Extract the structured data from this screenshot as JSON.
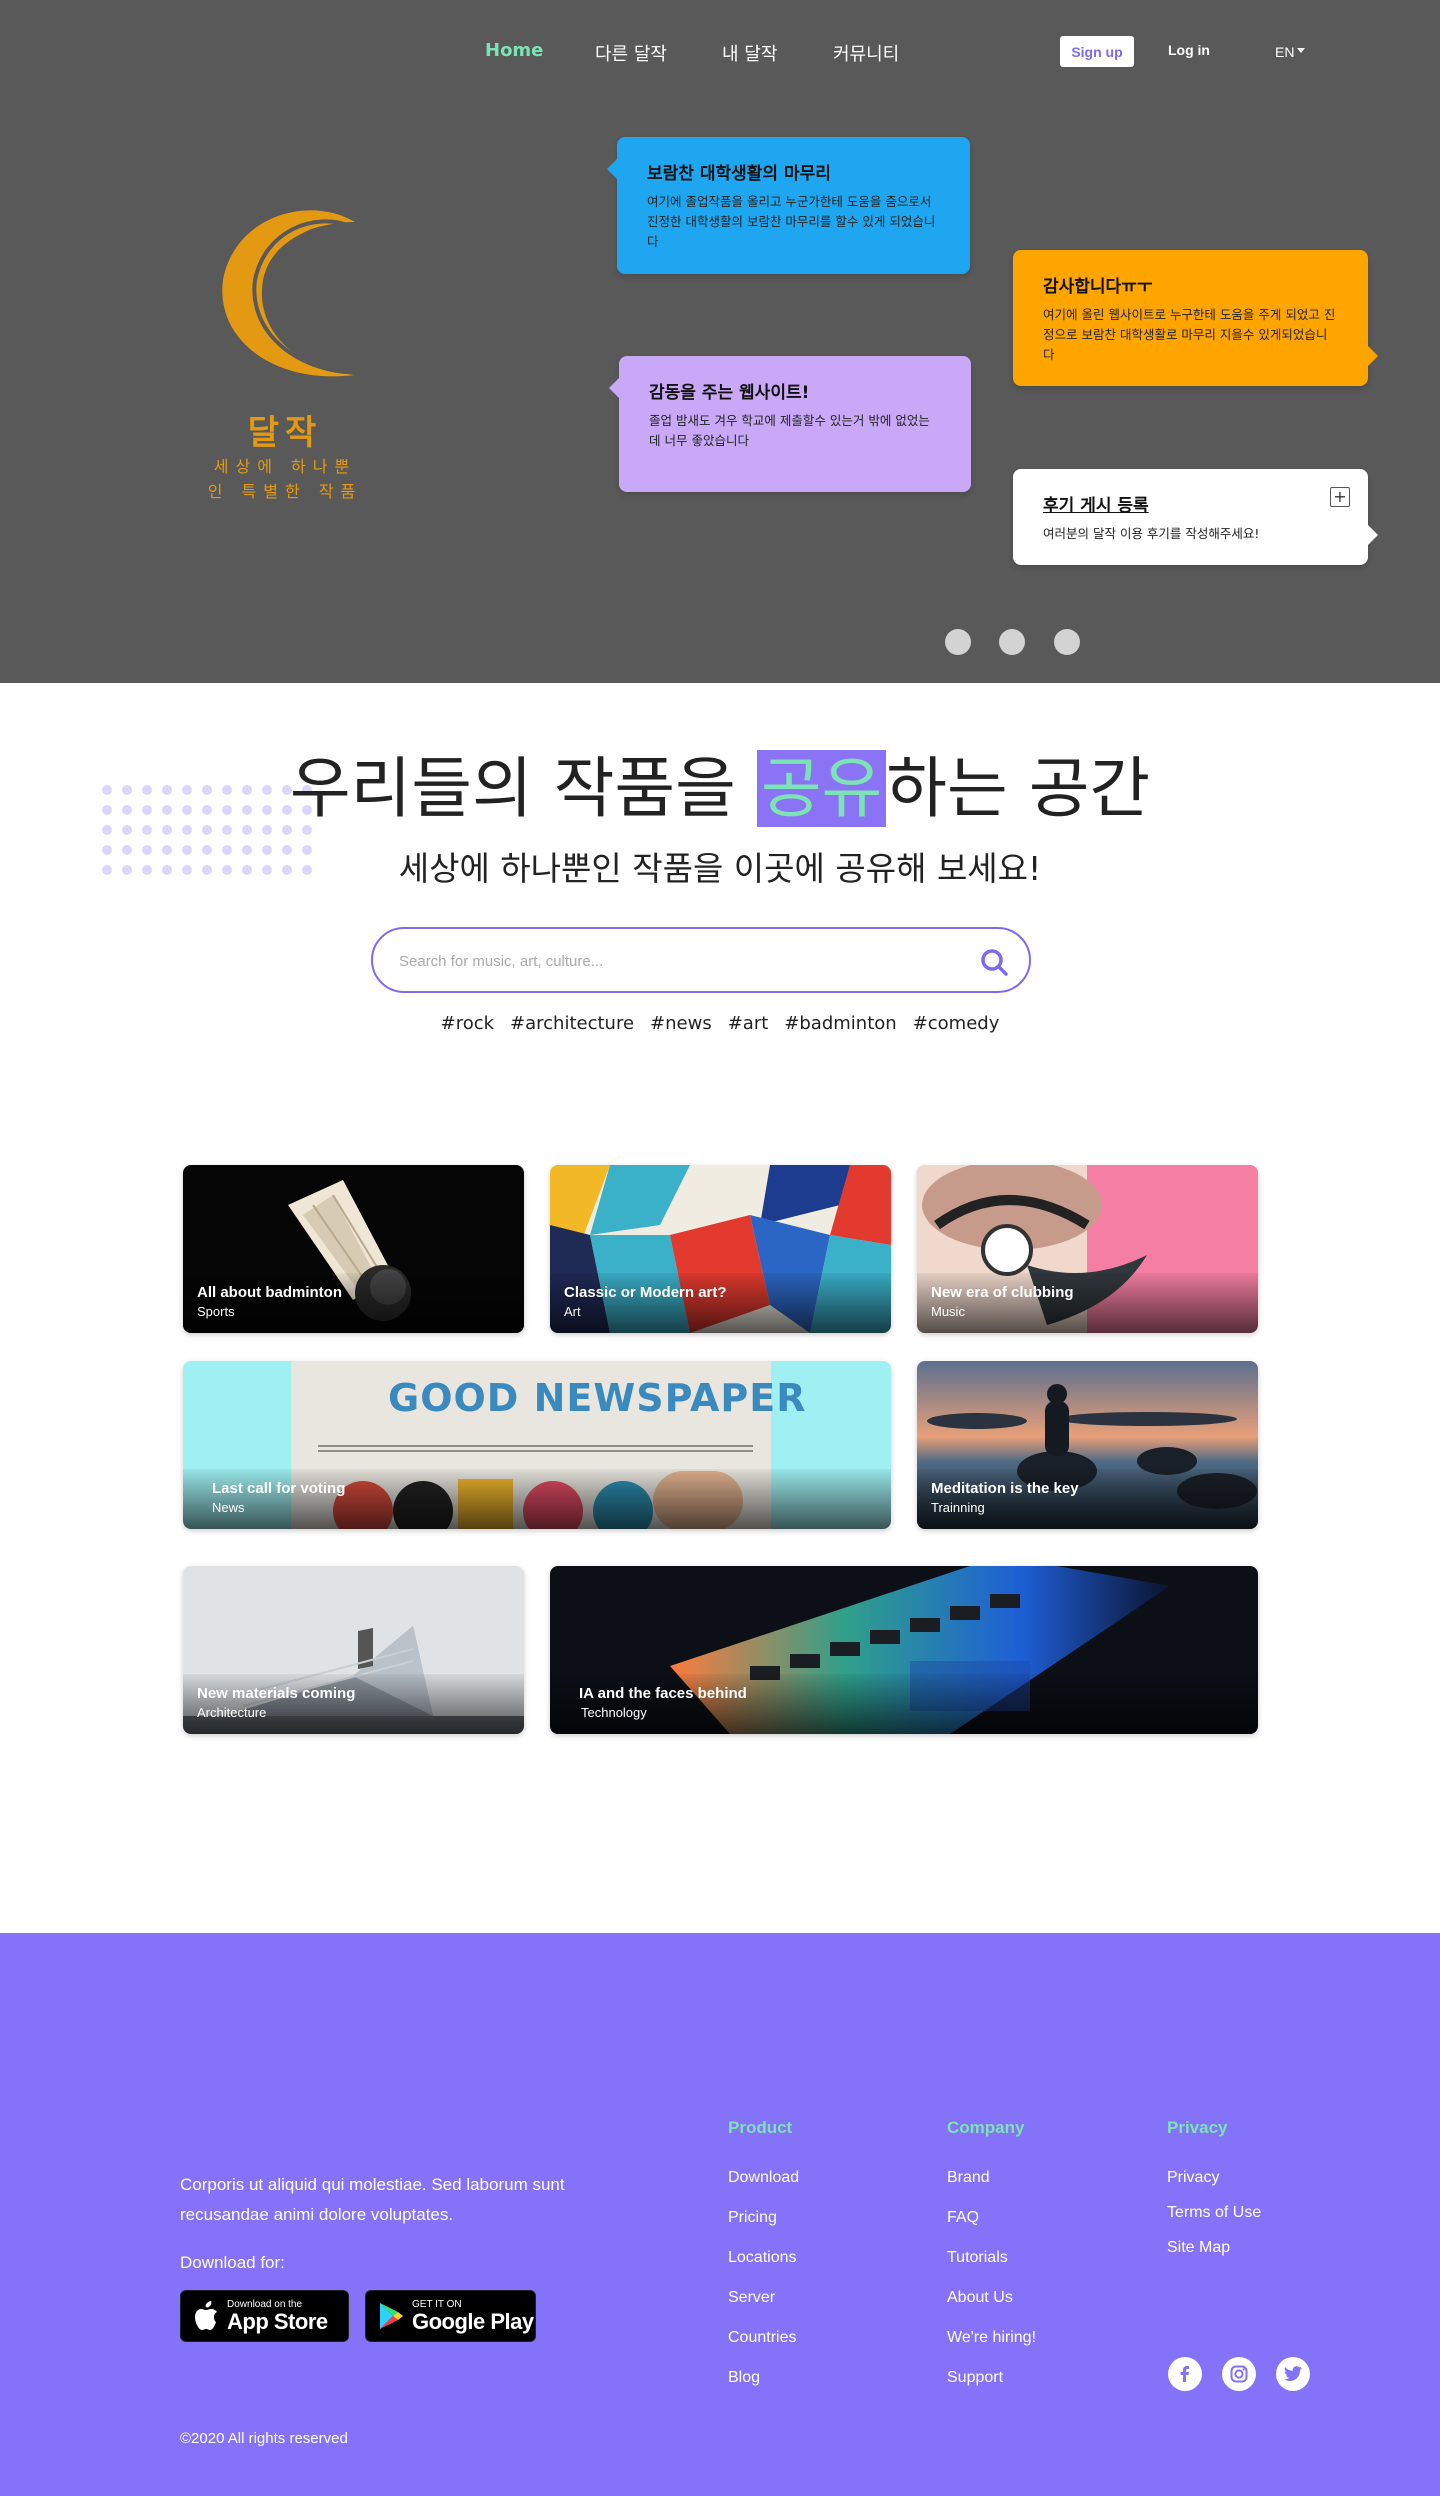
{
  "nav": {
    "links": [
      "Home",
      "다른 달작",
      "내 달작",
      "커뮤니티"
    ],
    "signup": "Sign up",
    "login": "Log in",
    "lang": "EN"
  },
  "logo": {
    "name": "달작",
    "tagline_1": "세상에 하나뿐",
    "tagline_2": "인 특별한 작품",
    "color": "#e39a12"
  },
  "bubbles": [
    {
      "title": "보람찬 대학생활의 마무리",
      "body": "여기에 졸업작품을 올리고 누군가한테 도움을 줌으로서 진정한 대학생활의 보람찬 마무리를 할수 있게 되었습니다",
      "color": "#1ea7f0"
    },
    {
      "title": "감동을 주는 웹사이트!",
      "body": "졸업 밤새도 겨우 학교에 제출할수 있는거 밖에 없었는데 너무 좋았습니다",
      "color": "#c9a9f7"
    },
    {
      "title": "감사합니다ㅠㅜ",
      "body": "여기에 올린 웹사이트로 누구한테 도움을 주게 되었고 진정으로 보람찬 대학생활로 마무리 지을수 있게되었습니다",
      "color": "#ffa500"
    },
    {
      "title": "후기 게시 등록",
      "body": "여러분의 달작 이용 후기를 작성해주세요!",
      "color": "#ffffff"
    }
  ],
  "hero_bg": "#595959",
  "headline": {
    "before": "우리들의 작품을 ",
    "highlight": "공유",
    "after": "하는 공간"
  },
  "subline": "세상에 하나뿐인 작품을 이곳에 공유해 보세요!",
  "search": {
    "placeholder": "Search for music, art, culture..."
  },
  "tags": [
    "#rock",
    "#architecture",
    "#news",
    "#art",
    "#badminton",
    "#comedy"
  ],
  "cards": [
    {
      "title": "All about badminton",
      "category": "Sports"
    },
    {
      "title": "Classic or Modern art?",
      "category": "Art"
    },
    {
      "title": "New era of clubbing",
      "category": "Music"
    },
    {
      "title": "Last call for voting",
      "category": "News",
      "image_text": "GOOD NEWSPAPER"
    },
    {
      "title": "Meditation is the key",
      "category": "Trainning"
    },
    {
      "title": "New materials coming",
      "category": "Architecture"
    },
    {
      "title": "IA and the faces behind",
      "category": "Technology"
    }
  ],
  "footer": {
    "bg": "#8472f8",
    "accent": "#7be3b4",
    "description": "Corporis ut aliquid qui molestiae. Sed laborum sunt recusandae animi dolore voluptates.",
    "download_label": "Download for:",
    "appstore": {
      "small": "Download on the",
      "big": "App Store"
    },
    "googleplay": {
      "small": "GET IT ON",
      "big": "Google Play"
    },
    "columns": [
      {
        "heading": "Product",
        "links": [
          "Download",
          "Pricing",
          "Locations",
          "Server",
          "Countries",
          "Blog"
        ]
      },
      {
        "heading": "Company",
        "links": [
          "Brand",
          "FAQ",
          "Tutorials",
          "About Us",
          "We're hiring!",
          "Support"
        ]
      },
      {
        "heading": "Privacy",
        "links": [
          "Privacy",
          "Terms of Use",
          "Site Map"
        ]
      }
    ],
    "social": [
      "facebook-icon",
      "instagram-icon",
      "twitter-icon"
    ],
    "copyright": "©2020 All rights reserved"
  }
}
